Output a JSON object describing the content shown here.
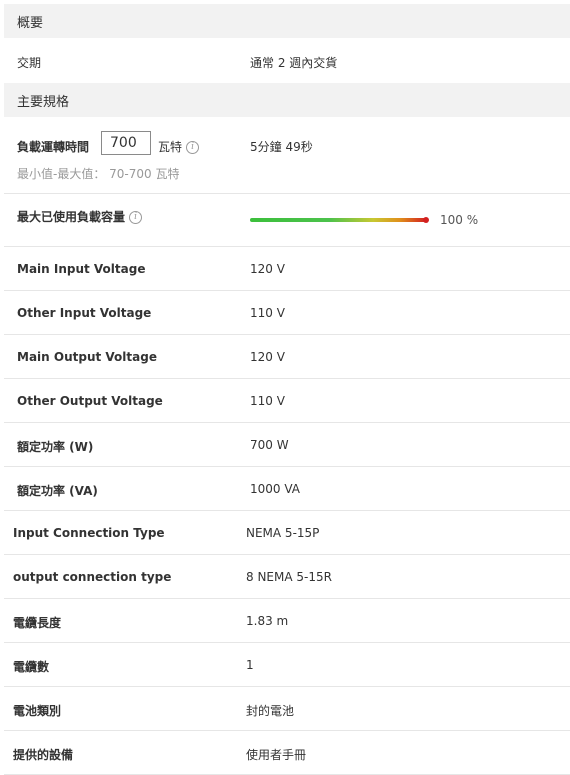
{
  "overview": {
    "header": "概要",
    "lead_time_label": "交期",
    "lead_time_value": "通常 2 週內交貨"
  },
  "specs": {
    "header": "主要規格",
    "runtime": {
      "label": "負載運轉時間",
      "input_value": "700",
      "unit": "瓦特",
      "info_icon": "i",
      "hint": "最小值-最大值： 70-700 瓦特",
      "result": "5分鐘 49秒"
    },
    "max_load": {
      "label": "最大已使用負載容量",
      "info_icon": "i",
      "percent_text": "100 %",
      "percent": 100,
      "bar_colors": [
        "#3cbf3c",
        "#c8c832",
        "#d32020"
      ]
    },
    "rows": [
      {
        "label": "Main Input Voltage",
        "value": "120 V"
      },
      {
        "label": "Other Input Voltage",
        "value": "110 V"
      },
      {
        "label": "Main Output Voltage",
        "value": "120 V"
      },
      {
        "label": "Other Output Voltage",
        "value": "110 V"
      },
      {
        "label": "額定功率 (W)",
        "value": "700 W"
      },
      {
        "label": "額定功率 (VA)",
        "value": "1000 VA"
      },
      {
        "label": "Input Connection Type",
        "value": "NEMA 5-15P"
      },
      {
        "label": "output connection type",
        "value": "8 NEMA 5-15R"
      },
      {
        "label": "電纜長度",
        "value": "1.83 m"
      },
      {
        "label": "電纜數",
        "value": "1"
      },
      {
        "label": "電池類別",
        "value": "封的電池"
      },
      {
        "label": "提供的設備",
        "value": "使用者手冊"
      }
    ]
  }
}
